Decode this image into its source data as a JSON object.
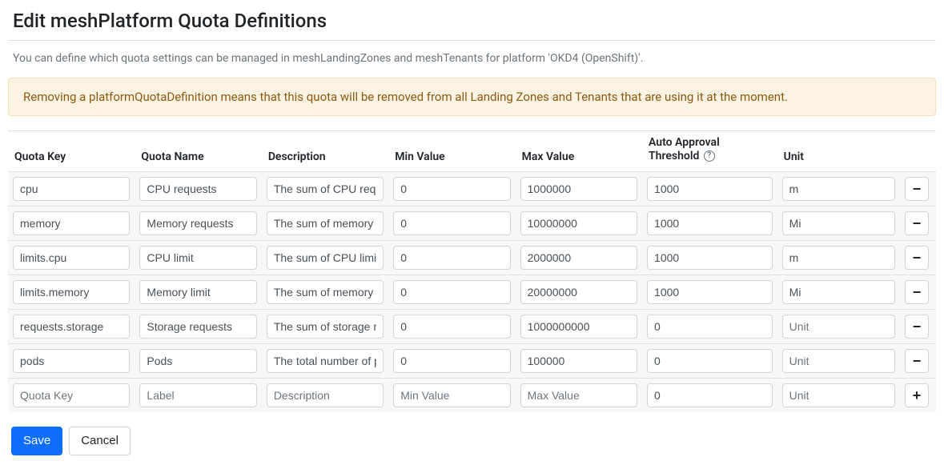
{
  "title": "Edit meshPlatform Quota Definitions",
  "intro": "You can define which quota settings can be managed in meshLandingZones and meshTenants for platform 'OKD4 (OpenShift)'.",
  "warning": "Removing a platformQuotaDefinition means that this quota will be removed from all Landing Zones and Tenants that are using it at the moment.",
  "headers": {
    "key": "Quota Key",
    "name": "Quota Name",
    "desc": "Description",
    "min": "Min Value",
    "max": "Max Value",
    "auto": "Auto Approval Threshold",
    "unit": "Unit"
  },
  "rows": [
    {
      "key": "cpu",
      "name": "CPU requests",
      "desc": "The sum of CPU requests",
      "min": "0",
      "max": "1000000",
      "auto": "1000",
      "unit": "m"
    },
    {
      "key": "memory",
      "name": "Memory requests",
      "desc": "The sum of memory requests",
      "min": "0",
      "max": "10000000",
      "auto": "1000",
      "unit": "Mi"
    },
    {
      "key": "limits.cpu",
      "name": "CPU limit",
      "desc": "The sum of CPU limits",
      "min": "0",
      "max": "2000000",
      "auto": "1000",
      "unit": "m"
    },
    {
      "key": "limits.memory",
      "name": "Memory limit",
      "desc": "The sum of memory limits",
      "min": "0",
      "max": "20000000",
      "auto": "1000",
      "unit": "Mi"
    },
    {
      "key": "requests.storage",
      "name": "Storage requests",
      "desc": "The sum of storage requests",
      "min": "0",
      "max": "1000000000",
      "auto": "0",
      "unit": "",
      "unit_placeholder": "Unit"
    },
    {
      "key": "pods",
      "name": "Pods",
      "desc": "The total number of pods",
      "min": "0",
      "max": "100000",
      "auto": "0",
      "unit": "",
      "unit_placeholder": "Unit"
    }
  ],
  "new_row": {
    "key_placeholder": "Quota Key",
    "name_placeholder": "Label",
    "desc_placeholder": "Description",
    "min_placeholder": "Min Value",
    "max_placeholder": "Max Value",
    "auto_value": "0",
    "unit_placeholder": "Unit"
  },
  "icons": {
    "remove": "−",
    "add": "+",
    "help": "?"
  },
  "buttons": {
    "save": "Save",
    "cancel": "Cancel"
  }
}
